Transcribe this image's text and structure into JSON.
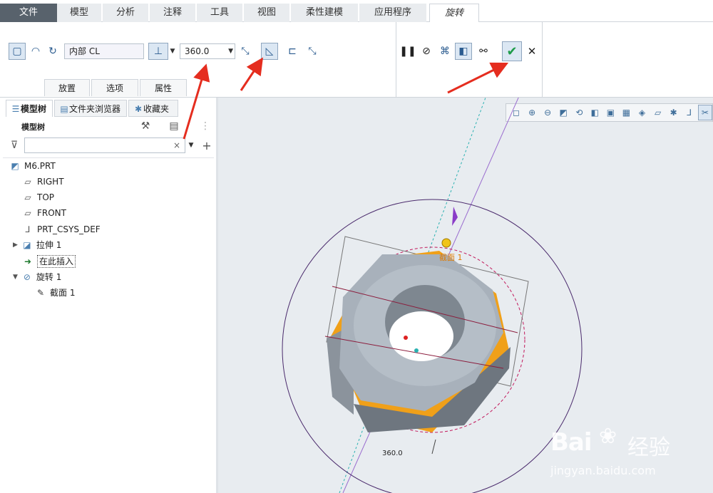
{
  "menu": {
    "tabs": [
      "文件",
      "模型",
      "分析",
      "注释",
      "工具",
      "视图",
      "柔性建模",
      "应用程序"
    ],
    "active_tab": "旋转"
  },
  "ribbon": {
    "sketch_field": "内部 CL",
    "angle_value": "360.0",
    "subtabs": [
      "放置",
      "选项",
      "属性"
    ]
  },
  "panel": {
    "tabs": [
      "模型树",
      "文件夹浏览器",
      "收藏夹"
    ],
    "heading": "模型树",
    "search_clear": "×",
    "tree": {
      "root": "M6.PRT",
      "right": "RIGHT",
      "top": "TOP",
      "front": "FRONT",
      "csys": "PRT_CSYS_DEF",
      "extrude": "拉伸 1",
      "insert_here": "在此插入",
      "revolve": "旋转 1",
      "section": "截面 1"
    }
  },
  "canvas": {
    "section_label": "截面 1",
    "dimension": "360.0",
    "watermark_brand": "Bai",
    "watermark_word": "经验",
    "watermark_url": "jingyan.baidu.com"
  },
  "colors": {
    "accent": "#2a5b8f",
    "arrow": "#e52d1f",
    "nut_gray": "#a8b1bb",
    "nut_orange": "#f0a019",
    "confirm": "#1f9c4a"
  }
}
